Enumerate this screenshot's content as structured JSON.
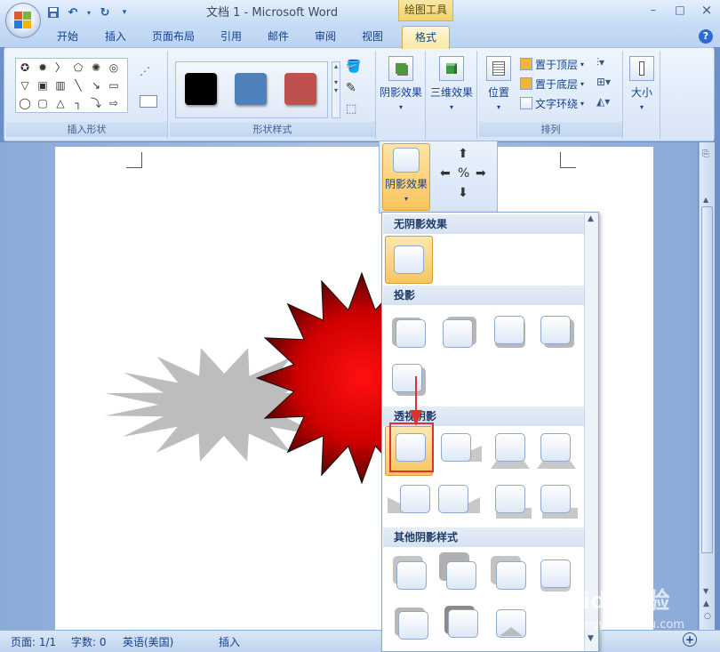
{
  "window": {
    "title": "文档 1 - Microsoft Word",
    "context_tab_group": "绘图工具",
    "minimize": "–",
    "maximize": "□",
    "close": "×"
  },
  "quick_access": [
    "save-icon",
    "undo-icon",
    "dropdown-arrow",
    "redo-icon",
    "customize-icon"
  ],
  "tabs": [
    "开始",
    "插入",
    "页面布局",
    "引用",
    "邮件",
    "审阅",
    "视图",
    "格式"
  ],
  "active_tab": "格式",
  "ribbon": {
    "groups": {
      "insert_shapes": "插入形状",
      "shape_styles": "形状样式",
      "arrange": "排列"
    },
    "shape_style_colors": [
      "#000000",
      "#4f81bd",
      "#c0504d"
    ],
    "buttons": {
      "shadow_effects": "阴影效果",
      "threed_effects": "三维效果",
      "position": "位置",
      "size": "大小",
      "bring_to_front": "置于顶层",
      "send_to_back": "置于底层",
      "text_wrap": "文字环绕"
    }
  },
  "shadow_panel": {
    "label": "阴影效果"
  },
  "gallery": {
    "sections": {
      "no_shadow": "无阴影效果",
      "drop_shadow": "投影",
      "perspective_shadow": "透视阴影",
      "other_shadow": "其他阴影样式"
    }
  },
  "statusbar": {
    "page": "页面: 1/1",
    "words": "字数: 0",
    "language": "英语(美国)",
    "insert_mode": "插入"
  },
  "watermark": {
    "brand": "Baidu经验",
    "url": "jingyan.baidu.com"
  },
  "colors": {
    "star_core": "#ff0000",
    "star_edge": "#2a0000",
    "shape_shadow": "#bdbdbd",
    "selection_orange": "#f8c460",
    "highlight_red": "#e03030"
  }
}
